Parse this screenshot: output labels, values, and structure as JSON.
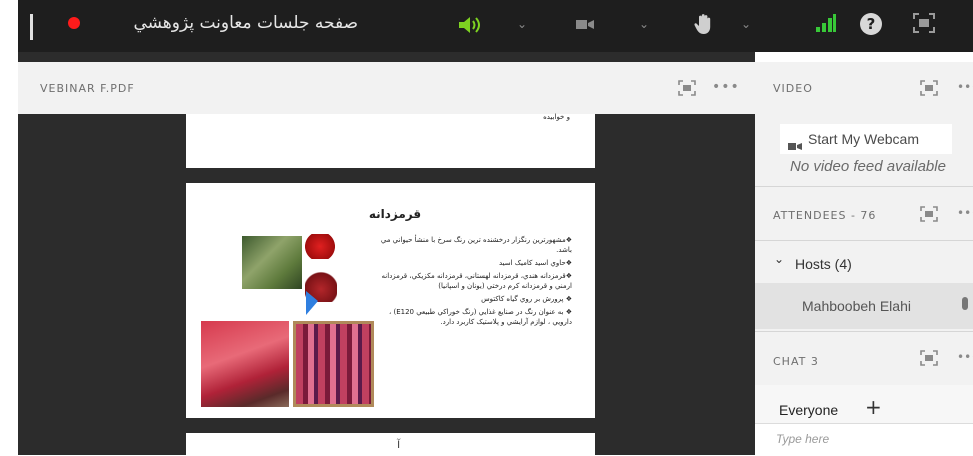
{
  "meeting": {
    "title": "صفحه جلسات معاونت پژوهشي",
    "recording_color": "#ff1b1b"
  },
  "toolbar_icons": [
    "speaker-icon",
    "camera-icon",
    "raise-hand-icon",
    "signal-icon",
    "help-icon",
    "fullscreen-icon"
  ],
  "document": {
    "file_name": "VEBINAR F.PDF",
    "prev_page_text": "و خوابيده",
    "slide": {
      "title": "قرمزدانه",
      "bullets": [
        "❖مشهورترين رنگزار درخشنده ترين رنگ سرخ با منشأ حيواني مي باشد.",
        "❖حاوي اسيد کاميک اسيد",
        "❖قرمزدانه هندي، قرمزدانه لهستاني، قرمزدانه مکزيکي، قرمزدانه ارمني و قرمزدانه کرم درختي (يونان و اسپانيا)",
        "❖ پرورش بر روي گياه کاکتوس",
        "❖ به عنوان رنگ در صنايع غذايي (رنگ خوراکي طبيعي E120) ، دارويي ، لوازم آرايشي و پلاستيک کاربرد دارد."
      ]
    },
    "next_page_text": "آ"
  },
  "video_pod": {
    "title": "VIDEO",
    "webcam_button": "Start My Webcam",
    "no_feed": "No video feed available"
  },
  "attendees_pod": {
    "title": "ATTENDEES - 76",
    "hosts_group": "Hosts (4)",
    "host_name": "Mahboobeh Elahi"
  },
  "chat_pod": {
    "title": "CHAT 3",
    "recipient": "Everyone",
    "add_label": "+",
    "input_placeholder": "Type here"
  }
}
